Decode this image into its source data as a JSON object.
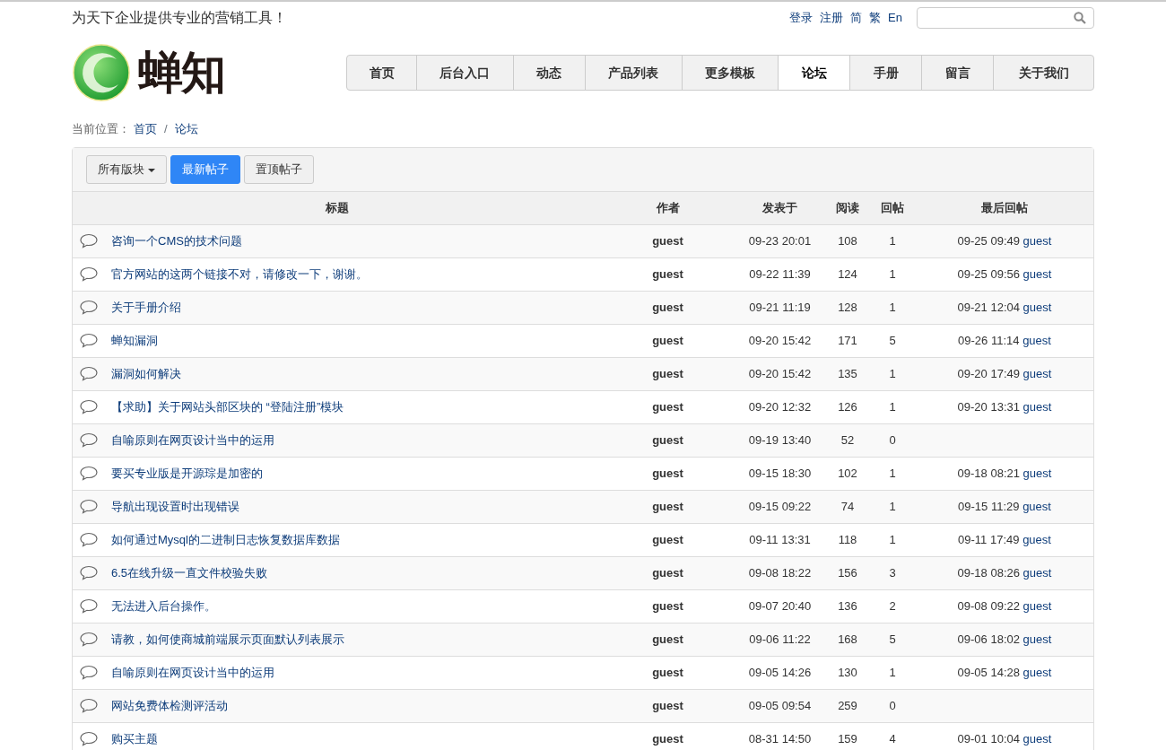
{
  "slogan": "为天下企业提供专业的营销工具！",
  "top_links": [
    "登录",
    "注册",
    "简",
    "繁",
    "En"
  ],
  "logo": {
    "text": "蝉知"
  },
  "nav": [
    {
      "label": "首页",
      "selected": false
    },
    {
      "label": "后台入口",
      "selected": false
    },
    {
      "label": "动态",
      "selected": false
    },
    {
      "label": "产品列表",
      "selected": false
    },
    {
      "label": "更多模板",
      "selected": false
    },
    {
      "label": "论坛",
      "selected": true
    },
    {
      "label": "手册",
      "selected": false
    },
    {
      "label": "留言",
      "selected": false
    },
    {
      "label": "关于我们",
      "selected": false
    }
  ],
  "breadcrumb": {
    "label": "当前位置：",
    "separator": "/",
    "items": [
      "首页",
      "论坛"
    ]
  },
  "filters": [
    {
      "label": "所有版块",
      "kind": "dropdown",
      "selected": false
    },
    {
      "label": "最新帖子",
      "kind": "button",
      "selected": true
    },
    {
      "label": "置顶帖子",
      "kind": "button",
      "selected": false
    }
  ],
  "table": {
    "columns": [
      "标题",
      "作者",
      "发表于",
      "阅读",
      "回帖",
      "最后回帖"
    ],
    "rows": [
      {
        "title": "咨询一个CMS的技术问题",
        "author": "guest",
        "posted": "09-23 20:01",
        "views": "108",
        "replies": "1",
        "last_time": "09-25 09:49",
        "last_user": "guest"
      },
      {
        "title": "官方网站的这两个链接不对，请修改一下，谢谢。",
        "author": "guest",
        "posted": "09-22 11:39",
        "views": "124",
        "replies": "1",
        "last_time": "09-25 09:56",
        "last_user": "guest"
      },
      {
        "title": "关于手册介绍",
        "author": "guest",
        "posted": "09-21 11:19",
        "views": "128",
        "replies": "1",
        "last_time": "09-21 12:04",
        "last_user": "guest"
      },
      {
        "title": "蝉知漏洞",
        "author": "guest",
        "posted": "09-20 15:42",
        "views": "171",
        "replies": "5",
        "last_time": "09-26 11:14",
        "last_user": "guest"
      },
      {
        "title": "漏洞如何解决",
        "author": "guest",
        "posted": "09-20 15:42",
        "views": "135",
        "replies": "1",
        "last_time": "09-20 17:49",
        "last_user": "guest"
      },
      {
        "title": "【求助】关于网站头部区块的 “登陆注册”模块",
        "author": "guest",
        "posted": "09-20 12:32",
        "views": "126",
        "replies": "1",
        "last_time": "09-20 13:31",
        "last_user": "guest"
      },
      {
        "title": "自喻原则在网页设计当中的运用",
        "author": "guest",
        "posted": "09-19 13:40",
        "views": "52",
        "replies": "0"
      },
      {
        "title": "要买专业版是开源琮是加密的",
        "author": "guest",
        "posted": "09-15 18:30",
        "views": "102",
        "replies": "1",
        "last_time": "09-18 08:21",
        "last_user": "guest"
      },
      {
        "title": "导航出现设置时出现错误",
        "author": "guest",
        "posted": "09-15 09:22",
        "views": "74",
        "replies": "1",
        "last_time": "09-15 11:29",
        "last_user": "guest"
      },
      {
        "title": "如何通过Mysql的二进制日志恢复数据库数据",
        "author": "guest",
        "posted": "09-11 13:31",
        "views": "118",
        "replies": "1",
        "last_time": "09-11 17:49",
        "last_user": "guest"
      },
      {
        "title": "6.5在线升级一直文件校验失败",
        "author": "guest",
        "posted": "09-08 18:22",
        "views": "156",
        "replies": "3",
        "last_time": "09-18 08:26",
        "last_user": "guest"
      },
      {
        "title": "无法进入后台操作。",
        "author": "guest",
        "posted": "09-07 20:40",
        "views": "136",
        "replies": "2",
        "last_time": "09-08 09:22",
        "last_user": "guest"
      },
      {
        "title": "请教，如何使商城前端展示页面默认列表展示",
        "author": "guest",
        "posted": "09-06 11:22",
        "views": "168",
        "replies": "5",
        "last_time": "09-06 18:02",
        "last_user": "guest"
      },
      {
        "title": "自喻原则在网页设计当中的运用",
        "author": "guest",
        "posted": "09-05 14:26",
        "views": "130",
        "replies": "1",
        "last_time": "09-05 14:28",
        "last_user": "guest"
      },
      {
        "title": "网站免费体检测评活动",
        "author": "guest",
        "posted": "09-05 09:54",
        "views": "259",
        "replies": "0"
      },
      {
        "title": "购买主题",
        "author": "guest",
        "posted": "08-31 14:50",
        "views": "159",
        "replies": "4",
        "last_time": "09-01 10:04",
        "last_user": "guest"
      }
    ]
  }
}
